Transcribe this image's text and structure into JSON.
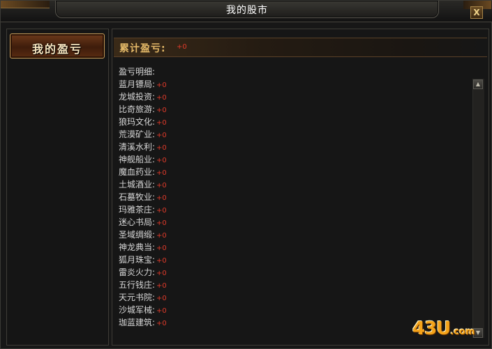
{
  "window": {
    "title": "我的股市",
    "close_label": "X"
  },
  "sidebar": {
    "tab_label": "我的盈亏"
  },
  "summary": {
    "label": "累计盈亏:",
    "value": "+0"
  },
  "details": {
    "heading": "盈亏明细:",
    "rows": [
      {
        "name": "蓝月镖局:",
        "value": "+0"
      },
      {
        "name": "龙城投资:",
        "value": "+0"
      },
      {
        "name": "比奇旅游:",
        "value": "+0"
      },
      {
        "name": "狼玛文化:",
        "value": "+0"
      },
      {
        "name": "荒漠矿业:",
        "value": "+0"
      },
      {
        "name": "清溪水利:",
        "value": "+0"
      },
      {
        "name": "神舰船业:",
        "value": "+0"
      },
      {
        "name": "魔血药业:",
        "value": "+0"
      },
      {
        "name": "土城酒业:",
        "value": "+0"
      },
      {
        "name": "石墓牧业:",
        "value": "+0"
      },
      {
        "name": "玛雅茶庄:",
        "value": "+0"
      },
      {
        "name": "迷心书局:",
        "value": "+0"
      },
      {
        "name": "圣域绸缎:",
        "value": "+0"
      },
      {
        "name": "神龙典当:",
        "value": "+0"
      },
      {
        "name": "狐月珠宝:",
        "value": "+0"
      },
      {
        "name": "雷炎火力:",
        "value": "+0"
      },
      {
        "name": "五行钱庄:",
        "value": "+0"
      },
      {
        "name": "天元书院:",
        "value": "+0"
      },
      {
        "name": "沙城军械:",
        "value": "+0"
      },
      {
        "name": "珈蓝建筑:",
        "value": "+0"
      }
    ]
  },
  "scrollbar": {
    "up_icon": "triangle-up-icon",
    "down_icon": "triangle-down-icon"
  },
  "watermark": {
    "main": "43U",
    "suffix": ".com"
  },
  "colors": {
    "value_red": "#e03a2a",
    "gold_label": "#e4b968",
    "tab_border": "#c59a58"
  }
}
